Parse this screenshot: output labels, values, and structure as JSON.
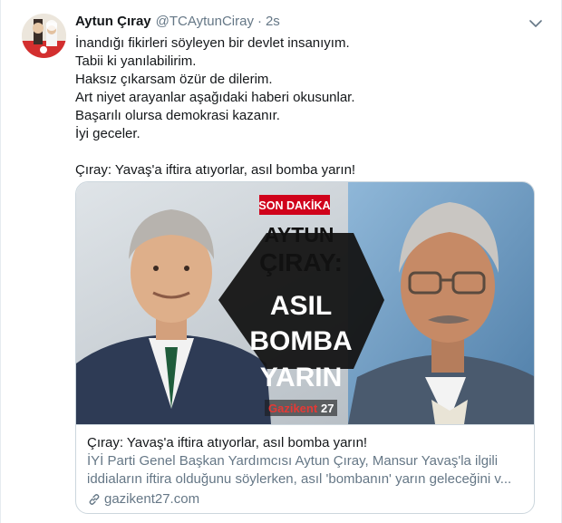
{
  "tweet": {
    "display_name": "Aytun Çıray",
    "handle": "@TCAytunCiray",
    "separator": "·",
    "time": "2s",
    "lines": [
      "İnandığı fikirleri söyleyen bir devlet insanıyım.",
      "Tabii ki yanılabilirim.",
      "Haksız çıkarsam özür de dilerim.",
      "Art niyet arayanlar aşağıdaki haberi okusunlar.",
      "Başarılı olursa demokrasi kazanır.",
      "İyi geceler."
    ],
    "headline_line": "Çıray: Yavaş'a iftira atıyorlar, asıl bomba yarın!"
  },
  "card": {
    "image_overlay": {
      "badge": "SON DAKİKA",
      "name_line_1": "AYTUN",
      "name_line_2": "ÇIRAY:",
      "headline_1": "ASIL",
      "headline_2": "BOMBA",
      "headline_3": "YARIN",
      "logo_main": "Gazikent",
      "logo_number": "27"
    },
    "title": "Çıray: Yavaş'a iftira atıyorlar, asıl bomba yarın!",
    "description_line_1": "İYİ Parti Genel Başkan Yardımcısı Aytun Çıray, Mansur Yavaş'la ilgili",
    "description_line_2": "iddiaların iftira olduğunu söylerken, asıl 'bombanın' yarın geleceğini v...",
    "domain": "gazikent27.com"
  },
  "colors": {
    "text_primary": "#14171a",
    "text_secondary": "#657786",
    "border": "#ccd6dd",
    "badge_red": "#d0021b",
    "hexagon_black": "#141414",
    "headline_white": "#ffffff"
  },
  "icons": {
    "avatar": "avatar",
    "caret": "chevron-down-icon",
    "link": "link-icon"
  }
}
